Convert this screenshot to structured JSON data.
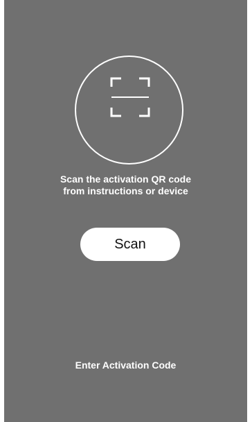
{
  "colors": {
    "background": "#707070",
    "foreground": "#ffffff",
    "button_text": "#111111"
  },
  "scan_area": {
    "icon": "qr-scan-frame-icon"
  },
  "instructions": {
    "line1": "Scan the activation QR code",
    "line2": "from instructions or device"
  },
  "scan_button": {
    "label": "Scan"
  },
  "enter_code": {
    "label": "Enter Activation Code"
  }
}
